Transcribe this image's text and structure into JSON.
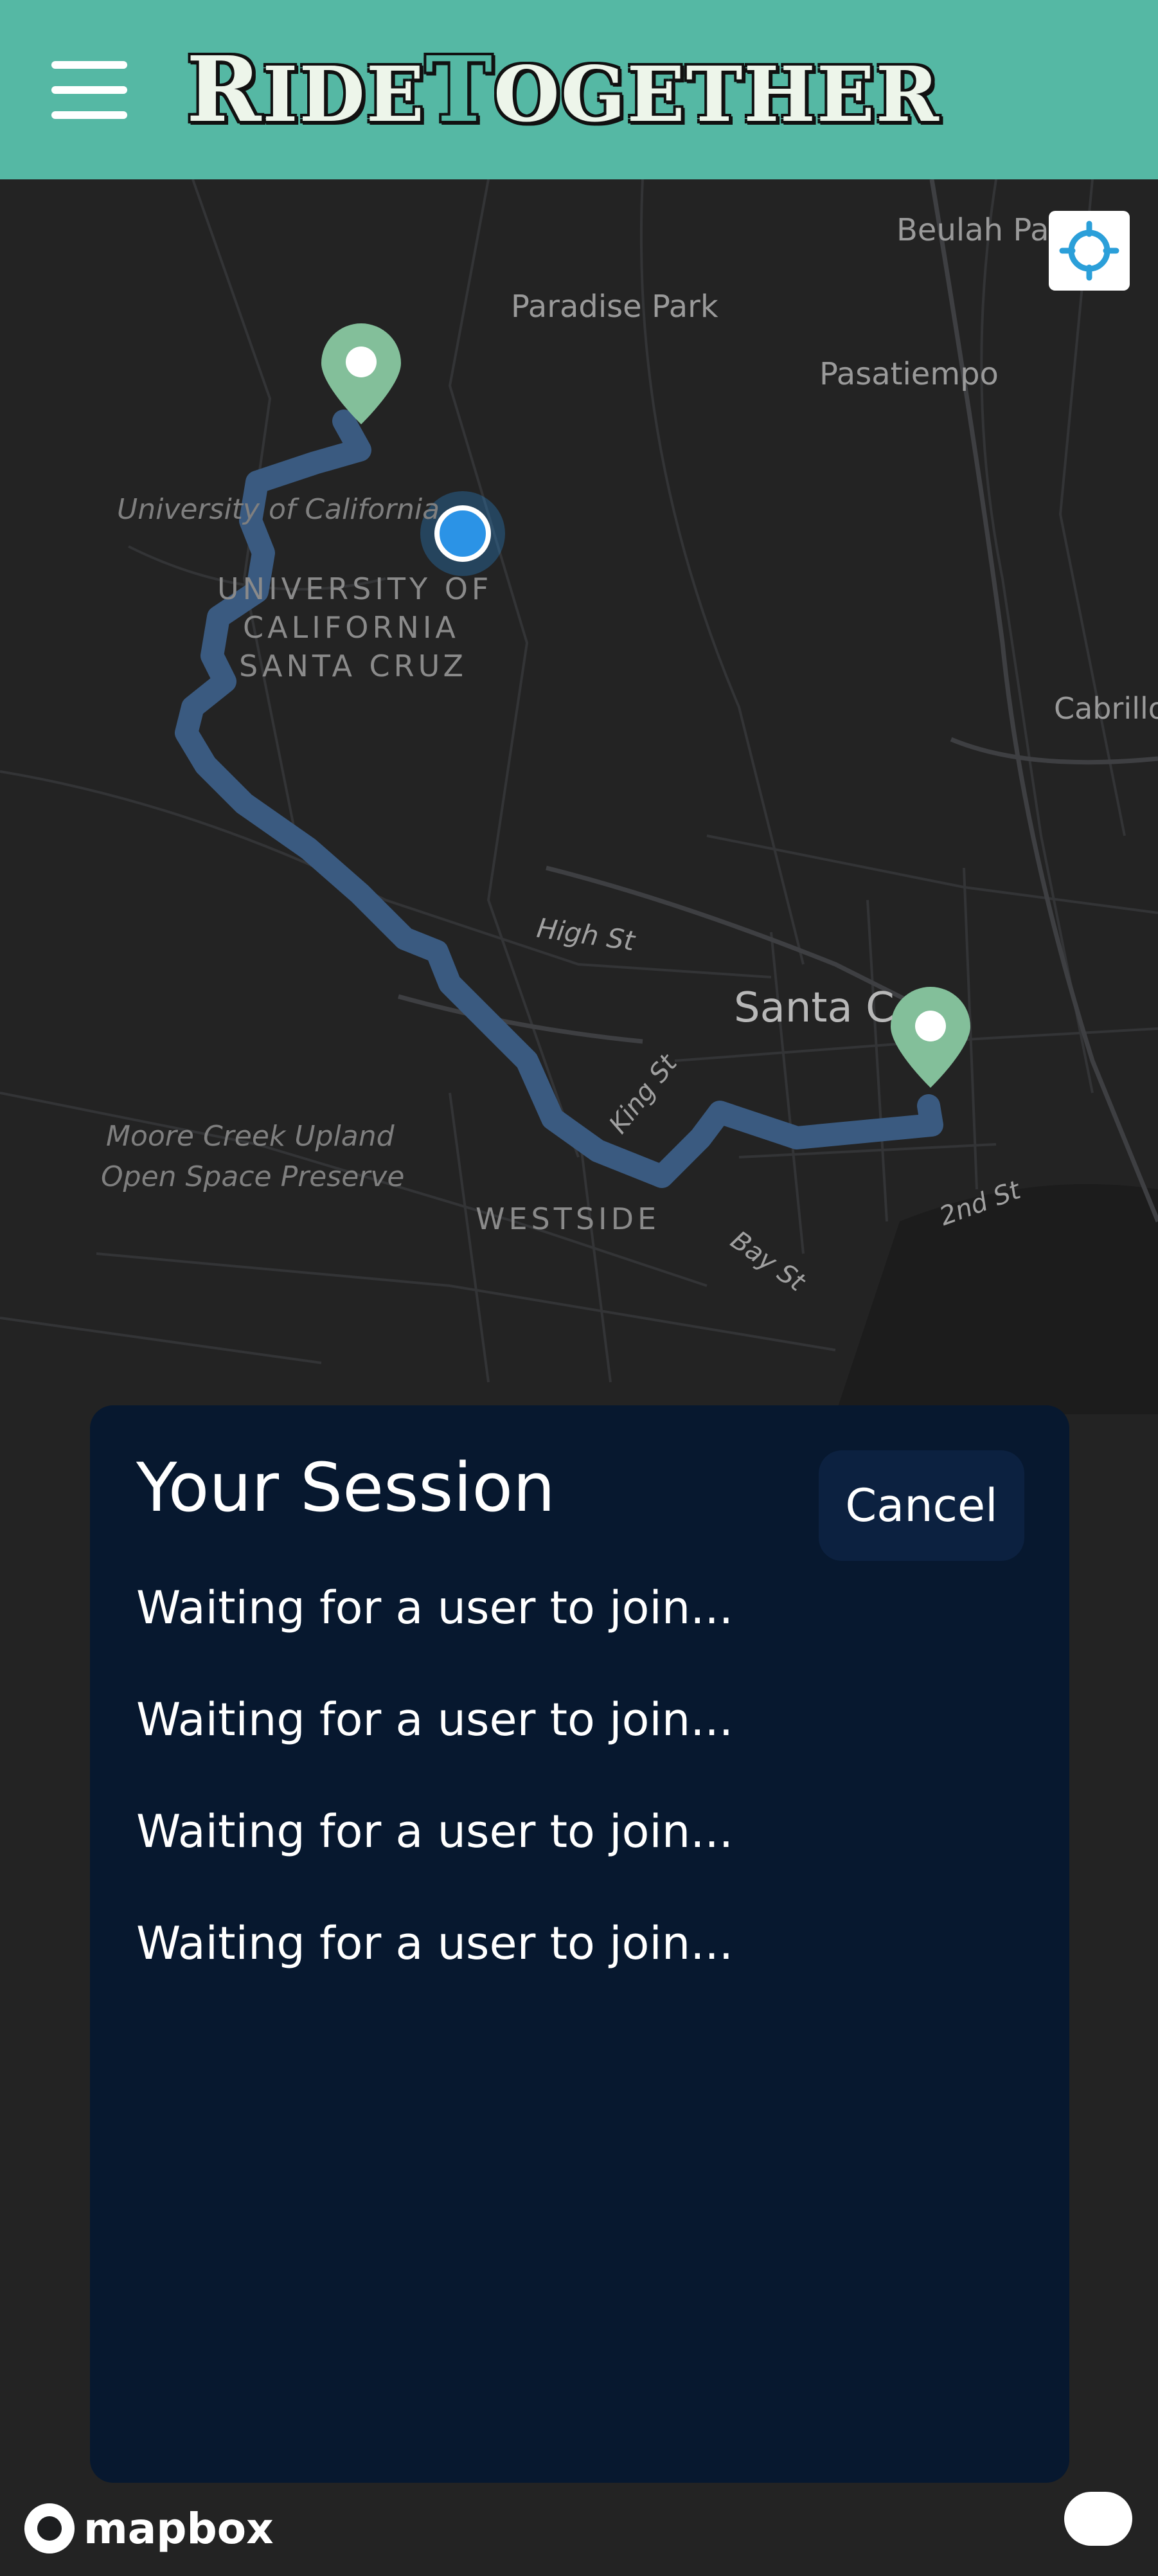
{
  "header": {
    "menu_icon": "hamburger-menu-icon",
    "logo_text": "RideTogether",
    "accent_color": "#55b8a4"
  },
  "map": {
    "labels": {
      "beulah_park": "Beulah Pa",
      "paradise_park": "Paradise Park",
      "pasatiempo": "Pasatiempo",
      "university_poi": "University of California",
      "campus_line1": "UNIVERSITY OF",
      "campus_line2": "CALIFORNIA",
      "campus_line3": "SANTA CRUZ",
      "cabrillo": "Cabrillo",
      "high_st": "High St",
      "santa_cruz": "Santa C",
      "king_st": "King St",
      "moore_creek_line1": "Moore Creek Upland",
      "moore_creek_line2": "Open Space Preserve",
      "westside": "WESTSIDE",
      "second_st": "2nd St",
      "bay_st": "Bay St"
    },
    "route_color": "#3a5a80",
    "pin_color": "#83bf9a",
    "user_location_color": "#2b93e6",
    "locate_icon": "crosshair-icon"
  },
  "session": {
    "title": "Your Session",
    "cancel_label": "Cancel",
    "slots": [
      "Waiting for a user to join...",
      "Waiting for a user to join...",
      "Waiting for a user to join...",
      "Waiting for a user to join..."
    ]
  },
  "footer": {
    "mapbox_label": "mapbox"
  }
}
